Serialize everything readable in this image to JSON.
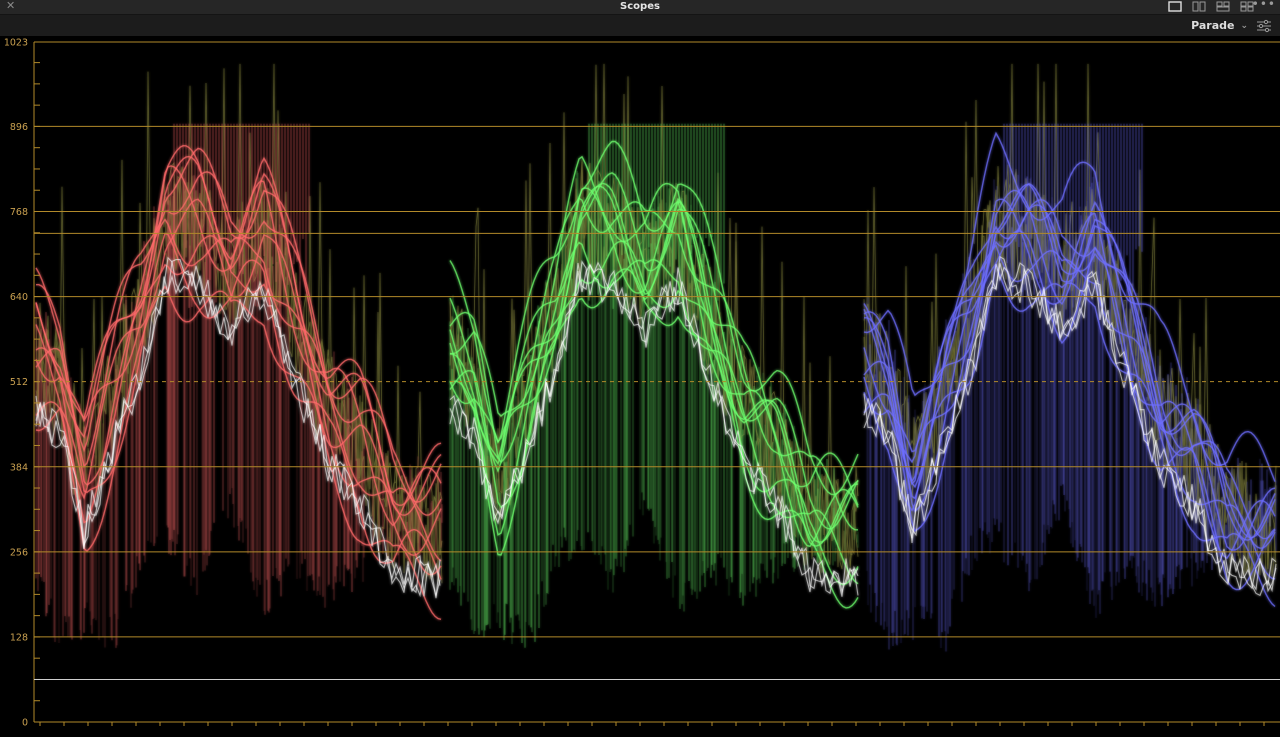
{
  "window": {
    "title": "Scopes",
    "close_glyph": "✕",
    "more_glyph": "•••",
    "layout_icons": [
      "single-view-icon",
      "dual-view-icon",
      "quad-view-icon",
      "grid-view-icon"
    ]
  },
  "toolbar": {
    "mode_label": "Parade",
    "mode_icon": "chevron-down-icon",
    "settings_icon": "sliders-settings-icon"
  },
  "scope": {
    "type": "rgb-parade",
    "scale_labels": [
      "1023",
      "896",
      "768",
      "640",
      "512",
      "384",
      "256",
      "128",
      "0"
    ],
    "scale_values": [
      1023,
      896,
      768,
      640,
      512,
      384,
      256,
      128,
      0
    ],
    "channels": [
      {
        "name": "red",
        "color": "#ff6a6a"
      },
      {
        "name": "green",
        "color": "#6dff6d"
      },
      {
        "name": "blue",
        "color": "#6e6eff"
      }
    ],
    "guide_color": "#b28a2a",
    "extra_guide_levels": [
      735,
      64
    ],
    "dashed_level": 512
  }
}
